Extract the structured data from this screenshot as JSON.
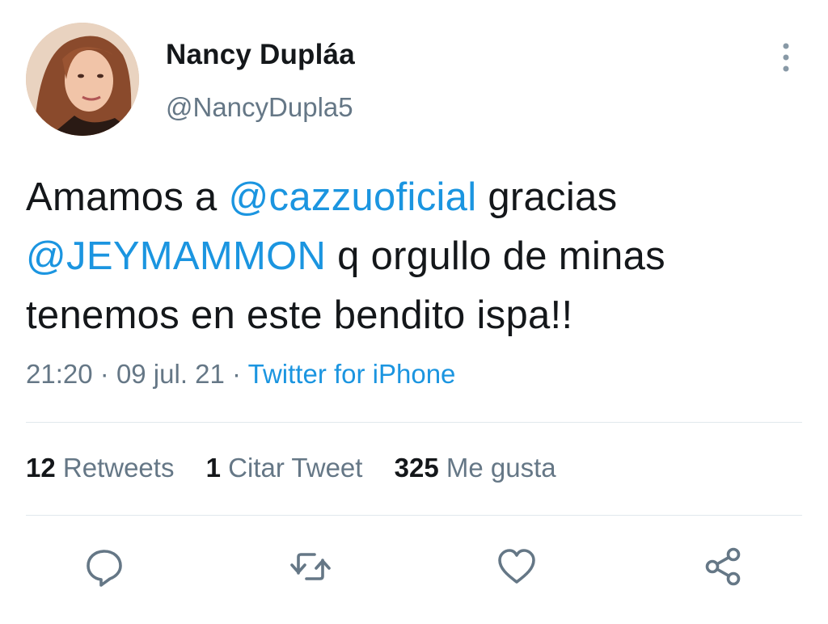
{
  "user": {
    "display_name": "Nancy Dupláa",
    "handle": "@NancyDupla5",
    "avatar_icon": "profile-photo"
  },
  "tweet": {
    "segments": [
      {
        "text": "Amamos a ",
        "type": "text"
      },
      {
        "text": "@cazzuoficial",
        "type": "mention"
      },
      {
        "text": " gracias ",
        "type": "text"
      },
      {
        "text": "@JEYMAMMON",
        "type": "mention"
      },
      {
        "text": " q orgullo de minas tenemos en este bendito ispa!!",
        "type": "text"
      }
    ]
  },
  "meta": {
    "time": "21:20",
    "separator": "·",
    "date": "09 jul. 21",
    "source": "Twitter for iPhone"
  },
  "stats": {
    "retweets_count": "12",
    "retweets_label": "Retweets",
    "quotes_count": "1",
    "quotes_label": "Citar Tweet",
    "likes_count": "325",
    "likes_label": "Me gusta"
  },
  "actions": [
    "reply-icon",
    "retweet-icon",
    "like-icon",
    "share-icon"
  ],
  "colors": {
    "link": "#1b95e0",
    "secondary_text": "#657786",
    "primary_text": "#14171a",
    "divider": "#e1e8ed"
  }
}
